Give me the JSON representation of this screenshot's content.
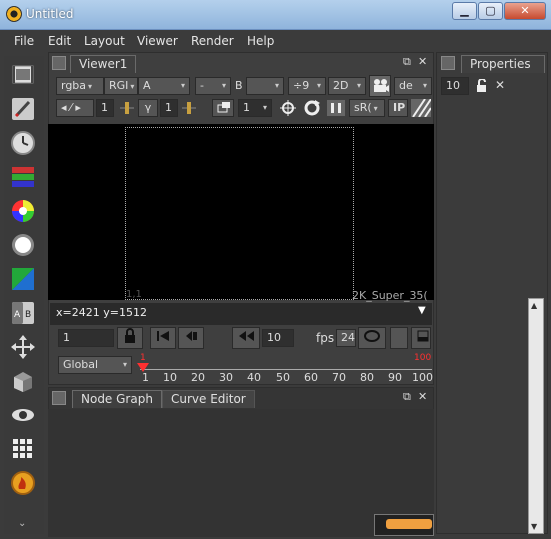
{
  "window": {
    "title": "Untitled",
    "min_label": "▁",
    "max_label": "▢",
    "close_label": "✕"
  },
  "menu": {
    "items": [
      "File",
      "Edit",
      "Layout",
      "Viewer",
      "Render",
      "Help"
    ]
  },
  "toolbar_icons": [
    "image-icon",
    "paint-brush-icon",
    "clock-icon",
    "color-channels-icon",
    "color-wheel-icon",
    "filter-icon",
    "keyer-icon",
    "merge-icon",
    "transform-icon",
    "3d-icon",
    "views-icon",
    "metadata-icon",
    "other-icon"
  ],
  "viewer": {
    "tab_label": "Viewer1",
    "float_icon": "⧉",
    "close_icon": "✕",
    "row1": {
      "channels": "rgba",
      "rgb": "RGI",
      "alpha": "A",
      "layer_a": "-",
      "b_label": "B",
      "gain": "÷9",
      "view_mode": "2D",
      "lut": "de"
    },
    "row2": {
      "frame_field": "1",
      "gamma_label": "γ",
      "gamma_value": "1",
      "proxy_value": "1",
      "colorspace": "sR(",
      "ip_label": "IP"
    },
    "format_origin": "1,1",
    "format_name": "2K_Super_35(",
    "status": "x=2421 y=1512"
  },
  "playback": {
    "frame": "1",
    "step_value": "10",
    "fps_label": "fps",
    "fps_value": "24"
  },
  "timeline": {
    "scope": "Global",
    "ticks": [
      "1",
      "10",
      "20",
      "30",
      "40",
      "50",
      "60",
      "70",
      "80",
      "90",
      "100"
    ],
    "in_marker": "1",
    "out_marker": "100",
    "accent_color": "#ff3030"
  },
  "bottom_panel": {
    "tabs": [
      "Node Graph",
      "Curve Editor"
    ],
    "float_icon": "⧉",
    "close_icon": "✕"
  },
  "properties": {
    "tab_label": "Properties",
    "max_panels": "10",
    "lock_icon": "🔓",
    "clear_label": "✕"
  }
}
